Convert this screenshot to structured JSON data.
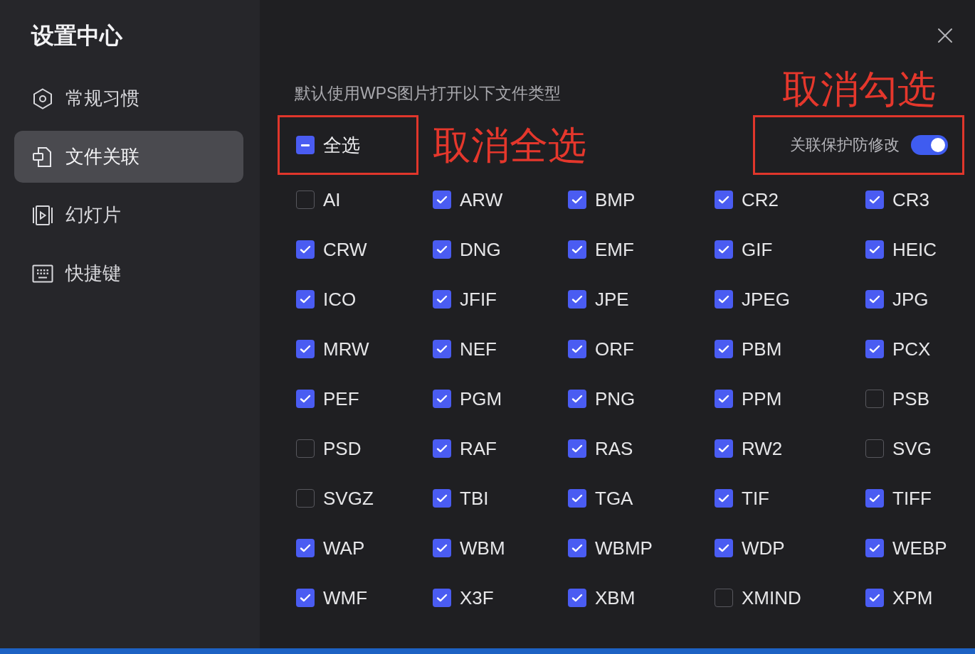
{
  "sidebar": {
    "title": "设置中心",
    "items": [
      {
        "label": "常规习惯",
        "selected": false
      },
      {
        "label": "文件关联",
        "selected": true
      },
      {
        "label": "幻灯片",
        "selected": false
      },
      {
        "label": "快捷键",
        "selected": false
      }
    ]
  },
  "description": "默认使用WPS图片打开以下文件类型",
  "protect_toggle": {
    "label": "关联保护防修改",
    "on": true,
    "annotation": "取消勾选"
  },
  "select_all": {
    "label": "全选",
    "indeterminate": true,
    "annotation": "取消全选"
  },
  "file_types": [
    {
      "label": "AI",
      "checked": false
    },
    {
      "label": "ARW",
      "checked": true
    },
    {
      "label": "BMP",
      "checked": true
    },
    {
      "label": "CR2",
      "checked": true
    },
    {
      "label": "CR3",
      "checked": true
    },
    {
      "label": "CRW",
      "checked": true
    },
    {
      "label": "DNG",
      "checked": true
    },
    {
      "label": "EMF",
      "checked": true
    },
    {
      "label": "GIF",
      "checked": true
    },
    {
      "label": "HEIC",
      "checked": true
    },
    {
      "label": "ICO",
      "checked": true
    },
    {
      "label": "JFIF",
      "checked": true
    },
    {
      "label": "JPE",
      "checked": true
    },
    {
      "label": "JPEG",
      "checked": true
    },
    {
      "label": "JPG",
      "checked": true
    },
    {
      "label": "MRW",
      "checked": true
    },
    {
      "label": "NEF",
      "checked": true
    },
    {
      "label": "ORF",
      "checked": true
    },
    {
      "label": "PBM",
      "checked": true
    },
    {
      "label": "PCX",
      "checked": true
    },
    {
      "label": "PEF",
      "checked": true
    },
    {
      "label": "PGM",
      "checked": true
    },
    {
      "label": "PNG",
      "checked": true
    },
    {
      "label": "PPM",
      "checked": true
    },
    {
      "label": "PSB",
      "checked": false
    },
    {
      "label": "PSD",
      "checked": false
    },
    {
      "label": "RAF",
      "checked": true
    },
    {
      "label": "RAS",
      "checked": true
    },
    {
      "label": "RW2",
      "checked": true
    },
    {
      "label": "SVG",
      "checked": false
    },
    {
      "label": "SVGZ",
      "checked": false
    },
    {
      "label": "TBI",
      "checked": true
    },
    {
      "label": "TGA",
      "checked": true
    },
    {
      "label": "TIF",
      "checked": true
    },
    {
      "label": "TIFF",
      "checked": true
    },
    {
      "label": "WAP",
      "checked": true
    },
    {
      "label": "WBM",
      "checked": true
    },
    {
      "label": "WBMP",
      "checked": true
    },
    {
      "label": "WDP",
      "checked": true
    },
    {
      "label": "WEBP",
      "checked": true
    },
    {
      "label": "WMF",
      "checked": true
    },
    {
      "label": "X3F",
      "checked": true
    },
    {
      "label": "XBM",
      "checked": true
    },
    {
      "label": "XMIND",
      "checked": false
    },
    {
      "label": "XPM",
      "checked": true
    }
  ]
}
